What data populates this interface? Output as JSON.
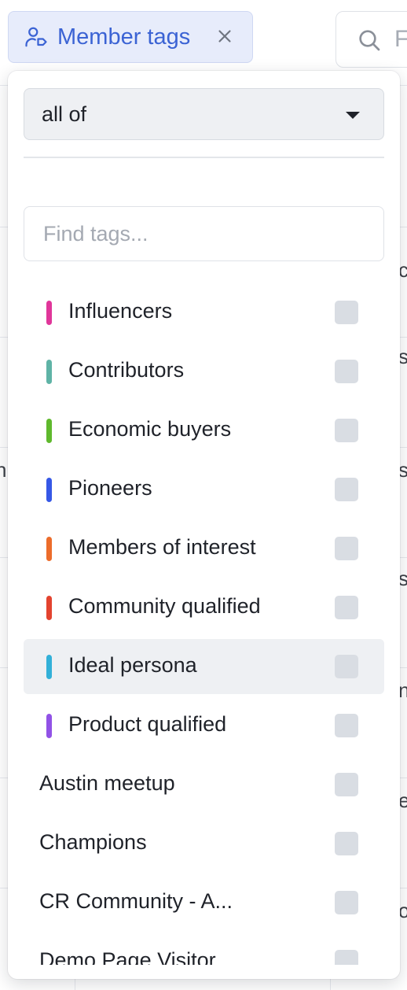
{
  "filter_chip": {
    "label": "Member tags",
    "icon": "user-tag-icon",
    "close_icon": "close-icon",
    "color": "#3b63d4"
  },
  "search": {
    "placeholder_fragment": "F",
    "icon": "search-icon"
  },
  "background_fragments": [
    "c",
    "s",
    "n",
    "s",
    "s",
    "n",
    "e",
    "o"
  ],
  "dropdown": {
    "match_mode": {
      "selected": "all of"
    },
    "find_placeholder": "Find tags...",
    "tags": [
      {
        "name": "Influencers",
        "color": "#e0369a",
        "checked": false
      },
      {
        "name": "Contributors",
        "color": "#5fb3a6",
        "checked": false
      },
      {
        "name": "Economic buyers",
        "color": "#5fb92d",
        "checked": false
      },
      {
        "name": "Pioneers",
        "color": "#3658e6",
        "checked": false
      },
      {
        "name": "Members of interest",
        "color": "#ec6c2b",
        "checked": false
      },
      {
        "name": "Community qualified",
        "color": "#e3432f",
        "checked": false
      },
      {
        "name": "Ideal persona",
        "color": "#32b0d8",
        "checked": false,
        "highlighted": true
      },
      {
        "name": "Product qualified",
        "color": "#9152e6",
        "checked": false
      },
      {
        "name": "Austin meetup",
        "color": null,
        "checked": false
      },
      {
        "name": "Champions",
        "color": null,
        "checked": false
      },
      {
        "name": "CR Community - A...",
        "color": null,
        "checked": false
      },
      {
        "name": "Demo Page Visitor",
        "color": null,
        "checked": false
      }
    ]
  }
}
